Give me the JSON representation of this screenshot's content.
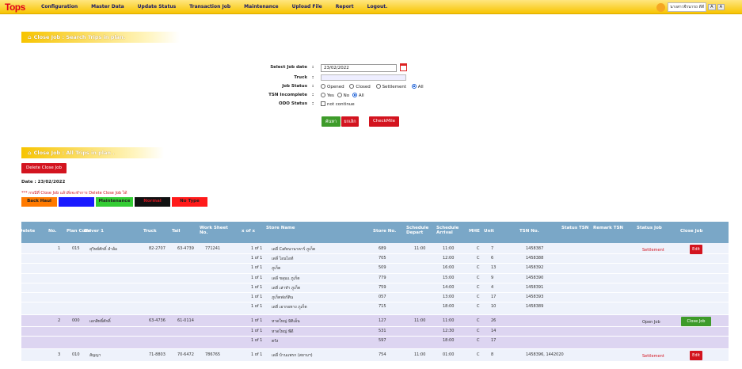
{
  "header": {
    "logo": "Tops",
    "menu": [
      "Configuration",
      "Master Data",
      "Update Status",
      "Transaction Job",
      "Maintenance",
      "Upload File",
      "Report",
      "Logout."
    ],
    "user": "นางสาวจีรนารถ ดีดี",
    "font_small": "A",
    "font_large": "A"
  },
  "search_title": "Close Job : Search Trips in plan.",
  "form": {
    "date_label": "Select Job date",
    "date_value": "23/02/2022",
    "truck_label": "Truck",
    "status_label": "Job Status",
    "status_options": [
      "Opened",
      "Closed",
      "Settlement",
      "All"
    ],
    "tsn_label": "TSN Incomplete",
    "tsn_options": [
      "Yes",
      "No",
      "All"
    ],
    "odo_label": "ODO Status",
    "odo_option": "not continue",
    "colon": ":",
    "search_btn": "ค้นหา",
    "cancel_btn": "ยกเลิก",
    "checkmile_btn": "CheckMile"
  },
  "trips_title": "Close Job : All Trips in plan .",
  "delete_btn": "Delete Close Job",
  "date_line": "Date : 23/02/2022",
  "note": "*** กรณีที่ Close Job แล้วสิ่งจะทำการ Delete Close Job ได้",
  "legend": [
    {
      "label": "Back Haul",
      "color": "#ff7a00"
    },
    {
      "label": "Cross Dock",
      "color": "#1a1aff"
    },
    {
      "label": "Maintenance",
      "color": "#33cc33"
    },
    {
      "label": "Normal",
      "color": "#111111"
    },
    {
      "label": "No Type",
      "color": "#ff1a1a"
    }
  ],
  "table": {
    "headers": [
      "Delete",
      "No.",
      "Plan Code",
      "Driver 1",
      "Truck",
      "Tail",
      "Work Sheet No.",
      "x of x",
      "Store Name",
      "Store No.",
      "Schedule Depart",
      "Schedule Arrival",
      "MHE",
      "Unit",
      "TSN No.",
      "Status TSN",
      "Remark TSN",
      "Status Job",
      "Close Job"
    ],
    "trips": [
      {
        "no": "1",
        "plan": "015",
        "driver": "สุวิทย์ศักดิ์ ลำล้อ",
        "truck": "82-2707",
        "tail": "63-4739",
        "ws": "771241",
        "depart": "11:00",
        "status_job": "Settlement",
        "status_red": true,
        "action": "Edit",
        "action_type": "edit",
        "bg": "#eef2fb",
        "stops": [
          {
            "xx": "1 of 1",
            "store": "เดลี่ Cafeนานาคาร์ ภูเก็ต",
            "sno": "689",
            "arr": "11:00",
            "mhe": "C",
            "unit": "7",
            "tsn": "1458387"
          },
          {
            "xx": "1 of 1",
            "store": "เดลี่ ไอนไอท์",
            "sno": "705",
            "arr": "12:00",
            "mhe": "C",
            "unit": "6",
            "tsn": "1458388"
          },
          {
            "xx": "1 of 1",
            "store": "ภูเก็ต",
            "sno": "509",
            "arr": "16:00",
            "mhe": "C",
            "unit": "13",
            "tsn": "1458392"
          },
          {
            "xx": "1 of 1",
            "store": "เดลี่ ขลุมแ ภูเก็ต",
            "sno": "779",
            "arr": "15:00",
            "mhe": "C",
            "unit": "9",
            "tsn": "1458390"
          },
          {
            "xx": "1 of 1",
            "store": "เดลี่ เล่าทำ ภูเก็ต",
            "sno": "759",
            "arr": "14:00",
            "mhe": "C",
            "unit": "4",
            "tsn": "1458391"
          },
          {
            "xx": "1 of 1",
            "store": "ภูเก็ตฟอร์ติน",
            "sno": "057",
            "arr": "13:00",
            "mhe": "C",
            "unit": "17",
            "tsn": "1458393"
          },
          {
            "xx": "1 of 1",
            "store": "เดลี่ เอากอทาง ภูเก็ต",
            "sno": "715",
            "arr": "18:00",
            "mhe": "C",
            "unit": "10",
            "tsn": "1458389"
          }
        ]
      },
      {
        "no": "2",
        "plan": "000",
        "driver": "เอกสิทธิ์ศักดิ์",
        "truck": "63-4736",
        "tail": "61-0114",
        "ws": "",
        "depart": "11:00",
        "status_job": "Open Job",
        "status_red": false,
        "action": "Close Job",
        "action_type": "close",
        "bg": "#ddd5f1",
        "stops": [
          {
            "xx": "1 of 1",
            "store": "หาดใหญ่ มิติเอ็น",
            "sno": "127",
            "arr": "11:00",
            "mhe": "C",
            "unit": "26",
            "tsn": ""
          },
          {
            "xx": "1 of 1",
            "store": "หาดใหญ่ พีดี",
            "sno": "531",
            "arr": "12:30",
            "mhe": "C",
            "unit": "14",
            "tsn": ""
          },
          {
            "xx": "1 of 1",
            "store": "ตรัง",
            "sno": "597",
            "arr": "18:00",
            "mhe": "C",
            "unit": "17",
            "tsn": ""
          }
        ]
      },
      {
        "no": "3",
        "plan": "010",
        "driver": "สัญญา",
        "truck": "71-8803",
        "tail": "70-6472",
        "ws": "786765",
        "depart": "11:00",
        "status_job": "Settlement",
        "status_red": true,
        "action": "Edit",
        "action_type": "edit",
        "bg": "#eef2fb",
        "stops": [
          {
            "xx": "1 of 1",
            "store": "เดลี่ บ้านแพรก (สยามฯ)",
            "sno": "754",
            "arr": "01:00",
            "mhe": "C",
            "unit": "8",
            "tsn": "1458396, 1442020"
          }
        ]
      }
    ]
  }
}
